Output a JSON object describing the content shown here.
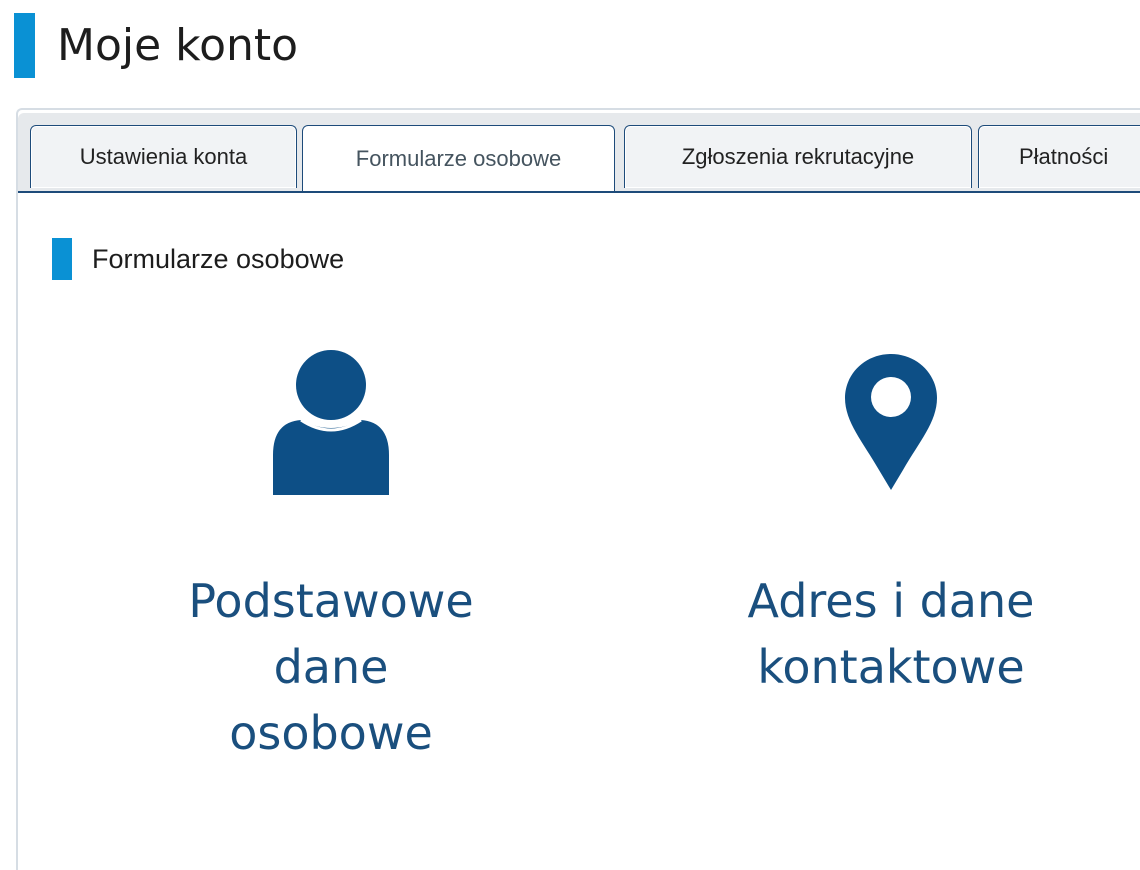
{
  "page": {
    "title": "Moje konto",
    "accent_color": "#0a91d4",
    "icon_color": "#0d4f86"
  },
  "tabs": [
    {
      "label": "Ustawienia konta",
      "active": false
    },
    {
      "label": "Formularze osobowe",
      "active": true
    },
    {
      "label": "Zgłoszenia rekrutacyjne",
      "active": false
    },
    {
      "label": "Płatności",
      "active": false
    }
  ],
  "section": {
    "title": "Formularze osobowe"
  },
  "tiles": [
    {
      "label": "Podstawowe\ndane\nosobowe",
      "icon": "user-icon"
    },
    {
      "label": "Adres i dane\nkontaktowe",
      "icon": "map-pin-icon"
    }
  ]
}
